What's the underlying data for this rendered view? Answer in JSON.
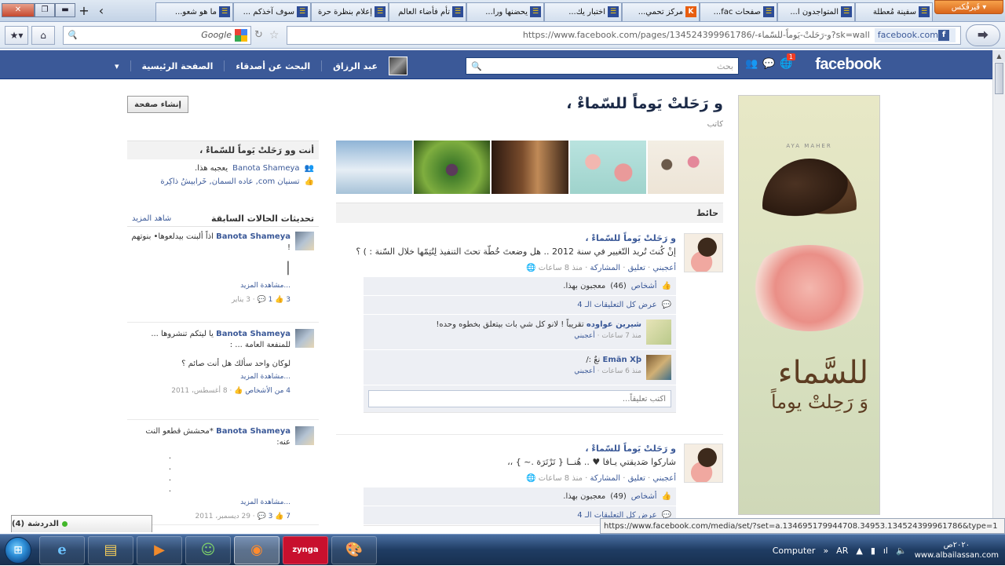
{
  "browser": {
    "firefox_button": "فَيرفُكس",
    "tabs": [
      {
        "title": "سفينة مُعطلة",
        "fav": "☰"
      },
      {
        "title": "المتواجدون ا...",
        "fav": "☰"
      },
      {
        "title": "صفحات fac...",
        "fav": "☰"
      },
      {
        "title": "مركز تحمي...",
        "fav": "K"
      },
      {
        "title": "اختبار يك...",
        "fav": "☰"
      },
      {
        "title": "يحضنها ورا...",
        "fav": "☰"
      },
      {
        "title": "تأم فأضاء العالم",
        "fav": "☰"
      },
      {
        "title": "إعلام بنظرة حرة",
        "fav": "☰"
      },
      {
        "title": "سوف آخذكم ...",
        "fav": "☰"
      },
      {
        "title": "ما هو شعو...",
        "fav": "☰"
      }
    ],
    "url_site": "facebook.com",
    "url_path": "https://www.facebook.com/pages/و-رَحَلتْ-يَوماً-للسّماء-/134524399961786?sk=wall",
    "search_placeholder": "Google",
    "status_url": "https://www.facebook.com/media/set/?set=a.134695179944708.34953.134524399961786&type=1"
  },
  "fb": {
    "logo": "facebook",
    "notif_count": "1",
    "search_placeholder": "بحث",
    "user_name": "عبد الرزاق",
    "nav_find_friends": "البحث عن أصدقاء",
    "nav_home": "الصفحة الرئيسية"
  },
  "page": {
    "title": "و رَحَلتْ يَوماً للسّماءْ ،",
    "category": "كاتب",
    "create_page_btn": "إنشاء صفحة",
    "wall_label": "حائط",
    "banner_caption": "AYA MAHER",
    "banner_text_1": "للسَّماء",
    "banner_text_2": "وَ رَحِلتْ يوماً"
  },
  "posts": [
    {
      "author": "و رَحَلتْ يَوماً للسّماءْ ،",
      "message": "إنْ كُنتَ تُريد التّغيير في سنة 2012 .. هل وضعتَ خُطّة تحتَ التنفيذ لِتُتِمّها خلال السّنة : ) ؟",
      "like": "أعجبني",
      "comment": "تعليق",
      "share": "المشاركة",
      "time": "منذ 8 ساعات",
      "likes_prefix": "أشخاص",
      "likes_count": "(46)",
      "likes_suffix": "معجبون بهذا.",
      "view_all": "عرض كل التعليقات الـ 4",
      "comments": [
        {
          "name": "شيرين عواوده",
          "text": "تقريباً ! لانو كل شي بات بيتعلق بخطوه وحده!",
          "time": "منذ 7 ساعات",
          "like": "أعجبني"
        },
        {
          "name": "Emän Xþ",
          "text": "نعٌ :/",
          "time": "منذ 6 ساعات",
          "like": "أعجبني"
        }
      ],
      "write_comment": "اكتب تعليقاً..."
    },
    {
      "author": "و رَحَلتْ يَوماً للسّماءْ ،",
      "message": "شاركوا صَديقتي يـافا ♥ .. هُنــا { تَرْتَرَة .~ } ،،",
      "like": "أعجبني",
      "comment": "تعليق",
      "share": "المشاركة",
      "time": "منذ 8 ساعات",
      "likes_prefix": "أشخاص",
      "likes_count": "(49)",
      "likes_suffix": "معجبون بهذا.",
      "view_all": "عرض كل التعليقات الـ 4"
    }
  ],
  "sidebar": {
    "likebox_title": "أنت وو رَحَلتْ يَوماً للسّماءْ ،",
    "like_line1_name": "Banota Shameya",
    "like_line1_suffix": "يعجبه هذا.",
    "like_line2": "تسنيان com, عاده السمان, خَرابيشُ ذاكِرة",
    "prev_title": "تحديثات الحالات السابقة",
    "prev_more": "شاهد المزيد",
    "statuses": [
      {
        "name": "Banota Shameya",
        "text": "اذاً ألبنت بيدلعوها• بنوتهم !",
        "extra": "|",
        "more": "...مشاهدة المزيد",
        "comments": "1",
        "likes": "3",
        "date": "3 يناير"
      },
      {
        "name": "Banota Shameya",
        "text": "يا ليتكم تنشروها ... للمنفعة العامة ... :",
        "extra": "لوكان واحد سألك هل أنت صائم ؟",
        "more": "...مشاهدة المزيد",
        "likes_text": "4 من الأشخاص",
        "date": "8 أغسطس، 2011"
      },
      {
        "name": "Banota Shameya",
        "text": "*محشش قطعو النت عنه:",
        "extra": ". . . .",
        "more": "...مشاهدة المزيد",
        "comments": "3",
        "likes": "7",
        "date": "29 ديسمبر، 2011"
      }
    ]
  },
  "chat": {
    "label": "الدردشة",
    "count": "(4)"
  },
  "taskbar": {
    "lang": "AR",
    "computer": "Computer",
    "time": "٢٠٢٠ص",
    "date": "www.albailassan.com"
  }
}
